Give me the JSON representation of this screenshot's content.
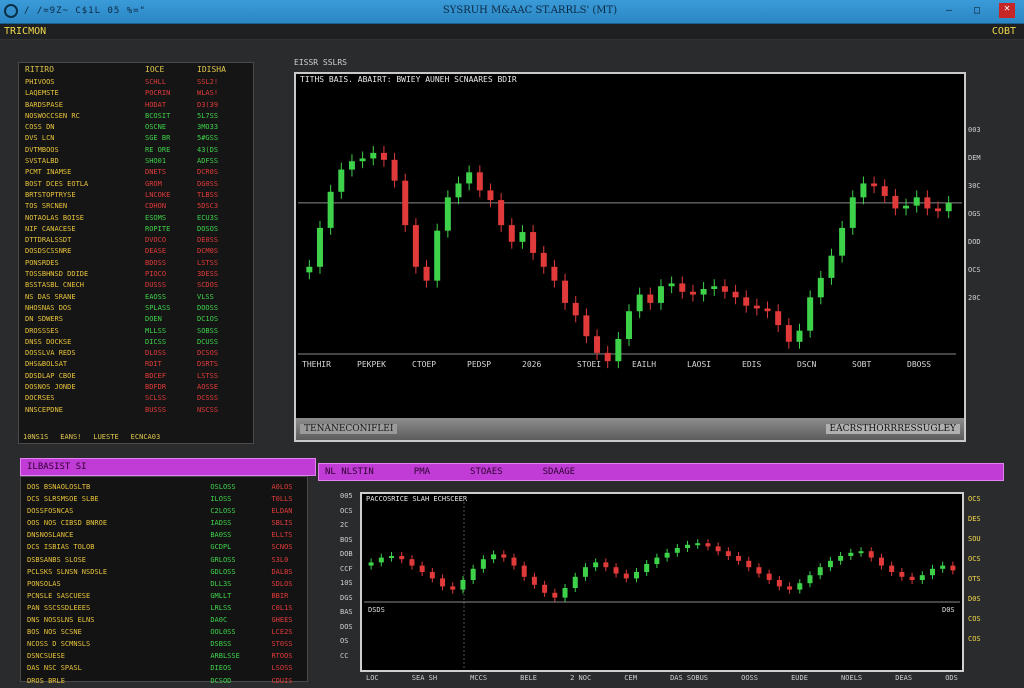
{
  "window": {
    "app_name": "/ /=9Z~ C$1L  05 %=\"",
    "title": "SYSRUH M&AAC ST.ARRLS' (MT)",
    "btn_min": "—",
    "btn_max": "□",
    "btn_close": "✕"
  },
  "menubar": {
    "left_label": "TRICMON",
    "right_label": "COBT"
  },
  "watchlist": {
    "header": [
      "RITIRO",
      "IOCE",
      "IDISHA"
    ],
    "rows": [
      {
        "sym": "PHIVOOS",
        "bid": "SCHLL",
        "ask": "SSL2!",
        "d": "dn"
      },
      {
        "sym": "LAQEMSTE",
        "bid": "POCRIN",
        "ask": "WLAS!",
        "d": "dn"
      },
      {
        "sym": "BARDSPASE",
        "bid": "HODAT",
        "ask": "D3(39",
        "d": "dn"
      },
      {
        "sym": "NOSWOCCSEN RC",
        "bid": "BCOSIT",
        "ask": "5L7SS",
        "d": "up"
      },
      {
        "sym": "COSS DN",
        "bid": "OSCNE",
        "ask": "3MO33",
        "d": "up"
      },
      {
        "sym": "DVS LCN",
        "bid": "SGE BR",
        "ask": "5#GSS",
        "d": "up"
      },
      {
        "sym": "DVTMBOOS",
        "bid": "RE ORE",
        "ask": "43(DS",
        "d": "up"
      },
      {
        "sym": "SVSTALBD",
        "bid": "SHO01",
        "ask": "ADFSS",
        "d": "up"
      },
      {
        "sym": "PCMT INAMSE",
        "bid": "DNETS",
        "ask": "DCR0S",
        "d": "dn"
      },
      {
        "sym": "BOST DCES EOTLA",
        "bid": "GROM",
        "ask": "DG0SS",
        "d": "dn"
      },
      {
        "sym": "BRTSTOPTRYSE",
        "bid": "LNCOKE",
        "ask": "TLBSS",
        "d": "dn"
      },
      {
        "sym": "TOS SRCNEN",
        "bid": "CDHON",
        "ask": "5DSC3",
        "d": "dn"
      },
      {
        "sym": "NOTAOLAS BOISE",
        "bid": "ESOMS",
        "ask": "ECU3S",
        "d": "up"
      },
      {
        "sym": "NIF CANACESE",
        "bid": "ROPITE",
        "ask": "DOSOS",
        "d": "up"
      },
      {
        "sym": "DTTDRALSSDT",
        "bid": "DVOCO",
        "ask": "DE0SS",
        "d": "dn"
      },
      {
        "sym": "DOSDSCSSNRE",
        "bid": "DEASE",
        "ask": "DCM0S",
        "d": "dn"
      },
      {
        "sym": "PONSRDES",
        "bid": "BDOSS",
        "ask": "LSTSS",
        "d": "dn"
      },
      {
        "sym": "TOSSBHNSD DDIDE",
        "bid": "PIOCO",
        "ask": "3DESS",
        "d": "dn"
      },
      {
        "sym": "BSSTASBL CNECH",
        "bid": "DUSSS",
        "ask": "SCDOS",
        "d": "dn"
      },
      {
        "sym": "NS DAS SRANE",
        "bid": "EAOSS",
        "ask": "VLSS",
        "d": "up"
      },
      {
        "sym": "NHOSNAS DOS",
        "bid": "SPLASS",
        "ask": "DOOSS",
        "d": "up"
      },
      {
        "sym": "DN SDWERS",
        "bid": "DOEN",
        "ask": "DC1OS",
        "d": "up"
      },
      {
        "sym": "DROSSSES",
        "bid": "MLLSS",
        "ask": "SOBSS",
        "d": "up"
      },
      {
        "sym": "DNSS DOCKSE",
        "bid": "DICSS",
        "ask": "DCUSS",
        "d": "up"
      },
      {
        "sym": "DOSSLVA REDS",
        "bid": "DLOSS",
        "ask": "DCSOS",
        "d": "dn"
      },
      {
        "sym": "DHS&BOLSAT",
        "bid": "RDIT",
        "ask": "DSRTS",
        "d": "dn"
      },
      {
        "sym": "DDSDLAP CBOE",
        "bid": "BDCEF",
        "ask": "LSTSS",
        "d": "dn"
      },
      {
        "sym": "DOSNOS JONDE",
        "bid": "BDFDR",
        "ask": "AOSSE",
        "d": "dn"
      },
      {
        "sym": "DOCRSES",
        "bid": "SCLSS",
        "ask": "DCSSS",
        "d": "dn"
      },
      {
        "sym": "NNSCEPDNE",
        "bid": "BUSSS",
        "ask": "NSCSS",
        "d": "dn"
      }
    ],
    "footer": [
      "10NS1S",
      "EANS!",
      "LUESTE",
      "ECNCA03"
    ]
  },
  "main_chart": {
    "caption": "EISSR SSLRS",
    "header": "TITHS  BAIS.  ABAIRT:  BWIEY  AUNEH   SCNAARES  BDIR",
    "footer_left": "TENANECONIFLEI",
    "footer_right": "EACRSTHORRRESSUGLEY",
    "x_labels": [
      "THEHIR",
      "PEKPEK",
      "CTOEP",
      "PEDSP",
      "2026",
      "STOEI",
      "EAILH",
      "LAOSI",
      "EDIS",
      "DSCN",
      "SOBT",
      "DBOSS"
    ],
    "right_axis": [
      "003",
      "DEM",
      "30C",
      "OGS",
      "DOD",
      "OCS",
      "20C"
    ]
  },
  "bottom_bar": {
    "left_label": "ILBASIST SI",
    "right_items": [
      "NL  NLSTIN",
      "PMA",
      "STOAES",
      "SDAAGE"
    ]
  },
  "watchlist2": {
    "rows": [
      {
        "sym": "DOS BSNAOLOSLTB",
        "bid": "OSLOSS",
        "ask": "A0LOS"
      },
      {
        "sym": "DCS SLRSMSOE  SLBE",
        "bid": "ILOSS",
        "ask": "T0LLS"
      },
      {
        "sym": "DOSSFOSNCAS",
        "bid": "C2LOSS",
        "ask": "ELDAN"
      },
      {
        "sym": "OOS NOS CIBSD BNROE",
        "bid": "IADSS",
        "ask": "SBLIS"
      },
      {
        "sym": "DNSNOSLANCE",
        "bid": "BA0SS",
        "ask": "ELLTS"
      },
      {
        "sym": "DCS ISBIAS TOLOB",
        "bid": "GCDPL",
        "ask": "SCNOS"
      },
      {
        "sym": "DSBSANBS SLOSE",
        "bid": "GRLOSS",
        "ask": "S3L0"
      },
      {
        "sym": "PCLSKS SLNSN NSDSLE",
        "bid": "GDLOSS",
        "ask": "DALBS"
      },
      {
        "sym": "PONSOLAS",
        "bid": "DLL3S",
        "ask": "SDLOS"
      },
      {
        "sym": "PCNSLE SASCUESE",
        "bid": "GMLLT",
        "ask": "BBIR"
      },
      {
        "sym": "PAN SSCSSDLEEES",
        "bid": "LRLSS",
        "ask": "C0L1S"
      },
      {
        "sym": "DNS NOSSLNS ELNS",
        "bid": "DA0C",
        "ask": "GHEES"
      },
      {
        "sym": "BOS NOS SCSNE",
        "bid": "OOL0SS",
        "ask": "LCE2S"
      },
      {
        "sym": "NCOSS D  SCMNSLS",
        "bid": "DSBSS",
        "ask": "ST0SS"
      },
      {
        "sym": "DSNCSUESE",
        "bid": "ARBLSSE",
        "ask": "RTOOS"
      },
      {
        "sym": "DAS NSC SPASL",
        "bid": "DIEOS",
        "ask": "LSOSS"
      },
      {
        "sym": "DROS  BRLE",
        "bid": "DCSOD",
        "ask": "CDUIS"
      }
    ]
  },
  "sub_chart": {
    "header": "PACCOSRICE SLAH  ECHSCEER",
    "left_axis": [
      "005",
      "OCS",
      "2C",
      "BOS",
      "DOB",
      "CCF",
      "10S",
      "DGS",
      "BAS",
      "DOS",
      "OS",
      "CC"
    ],
    "right_axis": [
      "OCS",
      "DES",
      "SOU",
      "OCS",
      "OTS",
      "D0S",
      "COS",
      "COS"
    ],
    "ref_left": "DSDS",
    "ref_right": "D0S",
    "time_labels": [
      "LOC",
      "SEA SH",
      "MCCS",
      "BELE",
      "2  NOC",
      "CEM",
      "DAS SOBUS",
      "OOSS",
      "EUDE",
      "NOELS",
      "DEAS",
      "ODS"
    ]
  },
  "colors": {
    "up": "#3ed14a",
    "down": "#e03a3a",
    "accent": "#c13cd6",
    "gridline": "#8a8a8a"
  },
  "chart_data": [
    {
      "type": "line",
      "title": "",
      "series": [
        {
          "values": [
            70,
            98,
            124,
            140,
            146,
            148,
            152,
            147,
            132,
            100,
            70,
            60,
            96,
            120,
            130,
            138,
            125,
            118,
            100,
            88,
            95,
            80,
            70,
            60,
            44,
            35,
            20,
            8,
            2,
            18,
            38,
            50,
            44,
            56,
            58,
            52,
            50,
            54,
            56,
            52,
            48,
            42,
            40,
            38,
            28,
            16,
            24,
            48,
            62,
            78,
            98,
            120,
            130,
            128,
            121,
            112,
            114,
            120,
            112,
            110,
            116
          ]
        }
      ],
      "ylim": [
        0,
        180
      ],
      "reference_line": 116
    },
    {
      "type": "line",
      "title": "",
      "series": [
        {
          "values": [
            52,
            58,
            60,
            56,
            48,
            40,
            32,
            22,
            18,
            30,
            44,
            56,
            62,
            58,
            48,
            34,
            24,
            14,
            8,
            20,
            34,
            46,
            52,
            46,
            38,
            32,
            40,
            50,
            58,
            64,
            70,
            74,
            76,
            72,
            66,
            60,
            54,
            46,
            38,
            30,
            22,
            18,
            26,
            36,
            46,
            54,
            60,
            64,
            66,
            58,
            48,
            40,
            34,
            30,
            36,
            44,
            48,
            42
          ]
        }
      ],
      "ylim": [
        0,
        100
      ]
    }
  ]
}
